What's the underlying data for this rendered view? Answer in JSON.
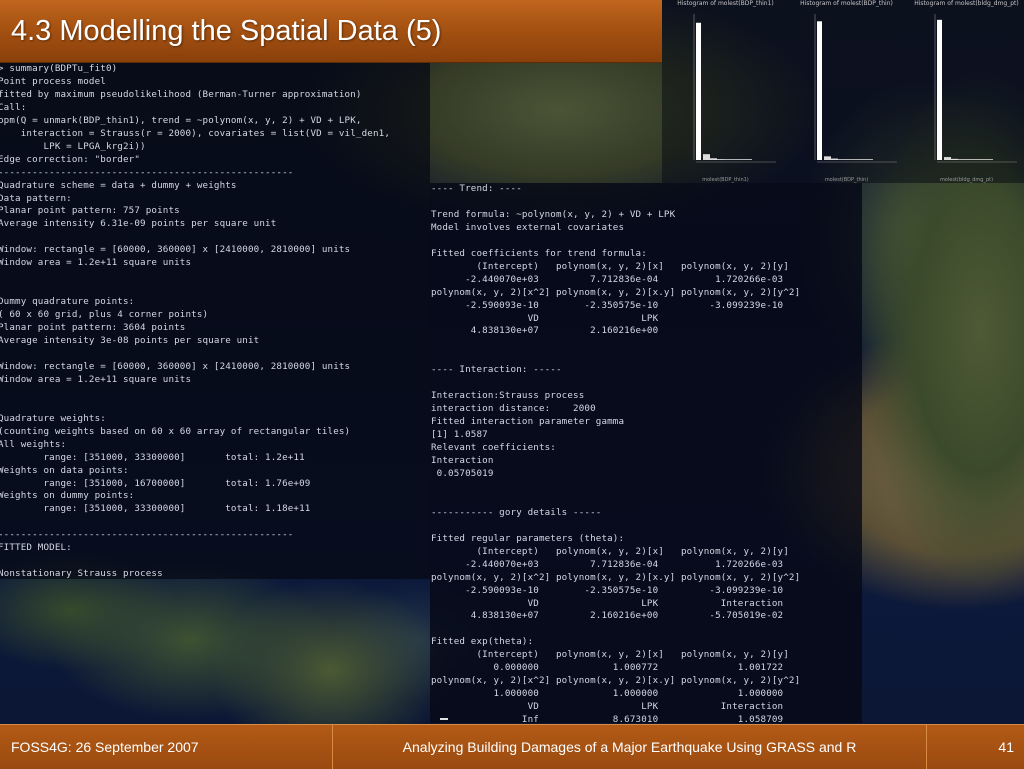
{
  "slide": {
    "title": "4.3 Modelling the Spatial Data (5)"
  },
  "console_left": [
    "> summary(BDPTu_fit0)",
    "Point process model",
    "fitted by maximum pseudolikelihood (Berman-Turner approximation)",
    "Call:",
    "ppm(Q = unmark(BDP_thin1), trend = ~polynom(x, y, 2) + VD + LPK,",
    "    interaction = Strauss(r = 2000), covariates = list(VD = vil_den1,",
    "        LPK = LPGA_krg2i))",
    "Edge correction: \"border\"",
    "----------------------------------------------------",
    "Quadrature scheme = data + dummy + weights",
    "Data pattern:",
    "Planar point pattern: 757 points",
    "Average intensity 6.31e-09 points per square unit",
    "",
    "Window: rectangle = [60000, 360000] x [2410000, 2810000] units",
    "Window area = 1.2e+11 square units",
    "",
    "",
    "Dummy quadrature points:",
    "( 60 x 60 grid, plus 4 corner points)",
    "Planar point pattern: 3604 points",
    "Average intensity 3e-08 points per square unit",
    "",
    "Window: rectangle = [60000, 360000] x [2410000, 2810000] units",
    "Window area = 1.2e+11 square units",
    "",
    "",
    "Quadrature weights:",
    "(counting weights based on 60 x 60 array of rectangular tiles)",
    "All weights:",
    "        range: [351000, 33300000]       total: 1.2e+11",
    "Weights on data points:",
    "        range: [351000, 16700000]       total: 1.76e+09",
    "Weights on dummy points:",
    "        range: [351000, 33300000]       total: 1.18e+11",
    "",
    "----------------------------------------------------",
    "FITTED MODEL:",
    "",
    "Nonstationary Strauss process"
  ],
  "console_right": [
    "---- Trend: ----",
    "",
    "Trend formula: ~polynom(x, y, 2) + VD + LPK",
    "Model involves external covariates",
    "",
    "Fitted coefficients for trend formula:",
    "        (Intercept)   polynom(x, y, 2)[x]   polynom(x, y, 2)[y]",
    "      -2.440070e+03         7.712836e-04          1.720266e-03",
    "polynom(x, y, 2)[x^2] polynom(x, y, 2)[x.y] polynom(x, y, 2)[y^2]",
    "      -2.590093e-10        -2.350575e-10         -3.099239e-10",
    "                 VD                  LPK",
    "       4.838130e+07         2.160216e+00",
    "",
    "",
    "---- Interaction: -----",
    "",
    "Interaction:Strauss process",
    "interaction distance:    2000",
    "Fitted interaction parameter gamma",
    "[1] 1.0587",
    "Relevant coefficients:",
    "Interaction",
    " 0.05705019",
    "",
    "",
    "----------- gory details -----",
    "",
    "Fitted regular parameters (theta):",
    "        (Intercept)   polynom(x, y, 2)[x]   polynom(x, y, 2)[y]",
    "      -2.440070e+03         7.712836e-04          1.720266e-03",
    "polynom(x, y, 2)[x^2] polynom(x, y, 2)[x.y] polynom(x, y, 2)[y^2]",
    "      -2.590093e-10        -2.350575e-10         -3.099239e-10",
    "                 VD                  LPK           Interaction",
    "       4.838130e+07         2.160216e+00         -5.705019e-02",
    "",
    "Fitted exp(theta):",
    "        (Intercept)   polynom(x, y, 2)[x]   polynom(x, y, 2)[y]",
    "           0.000000             1.000772              1.001722",
    "polynom(x, y, 2)[x^2] polynom(x, y, 2)[x.y] polynom(x, y, 2)[y^2]",
    "           1.000000             1.000000              1.000000",
    "                 VD                  LPK           Interaction",
    "                Inf             8.673010              1.058709"
  ],
  "histograms": [
    {
      "title": "Histogram of molest(BDP_thin1)",
      "xlabel": "molest(BDP_thin1)",
      "values": [
        0.94,
        0.04,
        0.012,
        0.006,
        0.003,
        0.002,
        0.001,
        0.001
      ]
    },
    {
      "title": "Histogram of molest(BDP_thin)",
      "xlabel": "molest(BDP_thin)",
      "values": [
        0.95,
        0.025,
        0.01,
        0.005,
        0.003,
        0.002,
        0.001,
        0.001
      ]
    },
    {
      "title": "Histogram of molest(bldg_dmg_pt)",
      "xlabel": "molest(bldg_dmg_pt)",
      "values": [
        0.96,
        0.02,
        0.008,
        0.004,
        0.002,
        0.001,
        0.001,
        0.001
      ]
    }
  ],
  "footer": {
    "left": "FOSS4G: 26 September 2007",
    "center": "Analyzing Building Damages of a Major Earthquake Using GRASS and R",
    "page": "41"
  },
  "colors": {
    "title_bar": "#a65212",
    "footer": "#9a4a10",
    "console_text": "#d4d8e4"
  }
}
